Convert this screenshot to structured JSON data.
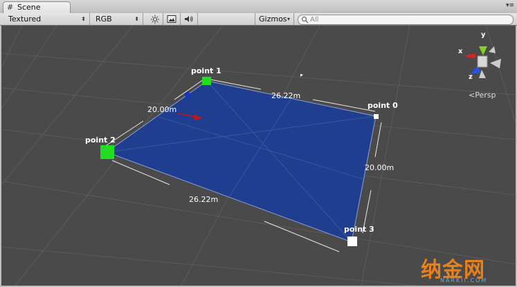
{
  "window": {
    "tab_label": "Scene",
    "tab_icon": "grid-icon",
    "menu_icon": "dropdown-menu-icon"
  },
  "toolbar": {
    "render_mode": "Textured",
    "color_mode": "RGB",
    "lighting_icon": "sun-icon",
    "effects_icon": "image-icon",
    "audio_icon": "speaker-icon",
    "gizmos_label": "Gizmos",
    "search_placeholder": "All",
    "search_icon": "search-icon"
  },
  "scene": {
    "points": [
      {
        "label": "point 0",
        "color": "#ffffff"
      },
      {
        "label": "point 1",
        "color": "#22dd22"
      },
      {
        "label": "point 2",
        "color": "#22dd22"
      },
      {
        "label": "point 3",
        "color": "#ffffff"
      }
    ],
    "dimensions": [
      {
        "label": "26.22m"
      },
      {
        "label": "20.00m"
      },
      {
        "label": "26.22m"
      },
      {
        "label": "20.00m"
      }
    ],
    "plane_color": "#1f3e8f",
    "grid_color": "#5a5a5a"
  },
  "gizmo": {
    "x_label": "x",
    "y_label": "y",
    "z_label": "z",
    "projection_label": "Persp",
    "x_color": "#dd2222",
    "y_color": "#7ed321",
    "z_color": "#2255ee"
  },
  "watermark": {
    "text": "纳金网",
    "subtext": "NARKII.COM"
  }
}
